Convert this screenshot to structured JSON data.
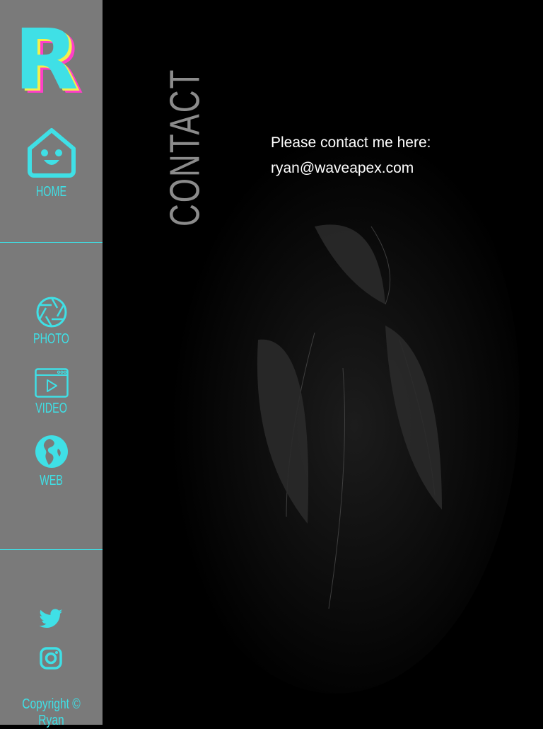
{
  "brand": {
    "logo_letter": "R"
  },
  "nav": {
    "home": "HOME",
    "photo": "PHOTO",
    "video": "VIDEO",
    "web": "WEB"
  },
  "social": {
    "twitter": "twitter-icon",
    "instagram": "instagram-icon"
  },
  "footer": {
    "copyright": "Copyright © Ryan"
  },
  "page": {
    "title": "CONTACT",
    "intro": "Please contact me here:",
    "email": "ryan@waveapex.com"
  },
  "colors": {
    "accent": "#3fe0e6",
    "logo_shadow_pink": "#ff3fc8",
    "logo_shadow_yellow": "#f2f04b",
    "sidebar_bg": "#7a7a7a",
    "main_bg": "#000000"
  }
}
